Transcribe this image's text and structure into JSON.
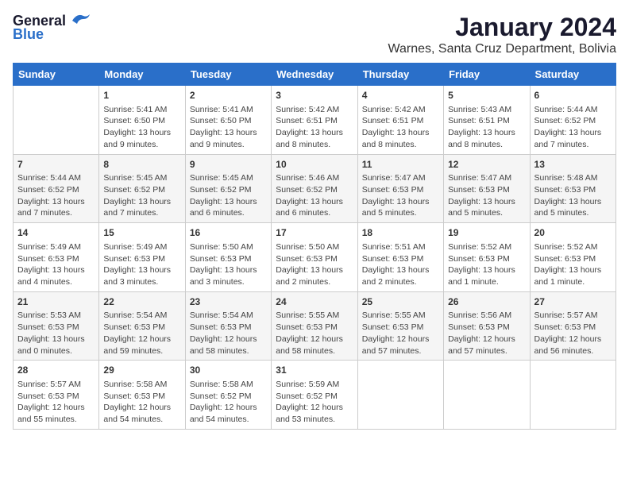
{
  "logo": {
    "general": "General",
    "blue": "Blue"
  },
  "title": "January 2024",
  "subtitle": "Warnes, Santa Cruz Department, Bolivia",
  "weekdays": [
    "Sunday",
    "Monday",
    "Tuesday",
    "Wednesday",
    "Thursday",
    "Friday",
    "Saturday"
  ],
  "weeks": [
    [
      {
        "day": "",
        "content": ""
      },
      {
        "day": "1",
        "content": "Sunrise: 5:41 AM\nSunset: 6:50 PM\nDaylight: 13 hours\nand 9 minutes."
      },
      {
        "day": "2",
        "content": "Sunrise: 5:41 AM\nSunset: 6:50 PM\nDaylight: 13 hours\nand 9 minutes."
      },
      {
        "day": "3",
        "content": "Sunrise: 5:42 AM\nSunset: 6:51 PM\nDaylight: 13 hours\nand 8 minutes."
      },
      {
        "day": "4",
        "content": "Sunrise: 5:42 AM\nSunset: 6:51 PM\nDaylight: 13 hours\nand 8 minutes."
      },
      {
        "day": "5",
        "content": "Sunrise: 5:43 AM\nSunset: 6:51 PM\nDaylight: 13 hours\nand 8 minutes."
      },
      {
        "day": "6",
        "content": "Sunrise: 5:44 AM\nSunset: 6:52 PM\nDaylight: 13 hours\nand 7 minutes."
      }
    ],
    [
      {
        "day": "7",
        "content": "Sunrise: 5:44 AM\nSunset: 6:52 PM\nDaylight: 13 hours\nand 7 minutes."
      },
      {
        "day": "8",
        "content": "Sunrise: 5:45 AM\nSunset: 6:52 PM\nDaylight: 13 hours\nand 7 minutes."
      },
      {
        "day": "9",
        "content": "Sunrise: 5:45 AM\nSunset: 6:52 PM\nDaylight: 13 hours\nand 6 minutes."
      },
      {
        "day": "10",
        "content": "Sunrise: 5:46 AM\nSunset: 6:52 PM\nDaylight: 13 hours\nand 6 minutes."
      },
      {
        "day": "11",
        "content": "Sunrise: 5:47 AM\nSunset: 6:53 PM\nDaylight: 13 hours\nand 5 minutes."
      },
      {
        "day": "12",
        "content": "Sunrise: 5:47 AM\nSunset: 6:53 PM\nDaylight: 13 hours\nand 5 minutes."
      },
      {
        "day": "13",
        "content": "Sunrise: 5:48 AM\nSunset: 6:53 PM\nDaylight: 13 hours\nand 5 minutes."
      }
    ],
    [
      {
        "day": "14",
        "content": "Sunrise: 5:49 AM\nSunset: 6:53 PM\nDaylight: 13 hours\nand 4 minutes."
      },
      {
        "day": "15",
        "content": "Sunrise: 5:49 AM\nSunset: 6:53 PM\nDaylight: 13 hours\nand 3 minutes."
      },
      {
        "day": "16",
        "content": "Sunrise: 5:50 AM\nSunset: 6:53 PM\nDaylight: 13 hours\nand 3 minutes."
      },
      {
        "day": "17",
        "content": "Sunrise: 5:50 AM\nSunset: 6:53 PM\nDaylight: 13 hours\nand 2 minutes."
      },
      {
        "day": "18",
        "content": "Sunrise: 5:51 AM\nSunset: 6:53 PM\nDaylight: 13 hours\nand 2 minutes."
      },
      {
        "day": "19",
        "content": "Sunrise: 5:52 AM\nSunset: 6:53 PM\nDaylight: 13 hours\nand 1 minute."
      },
      {
        "day": "20",
        "content": "Sunrise: 5:52 AM\nSunset: 6:53 PM\nDaylight: 13 hours\nand 1 minute."
      }
    ],
    [
      {
        "day": "21",
        "content": "Sunrise: 5:53 AM\nSunset: 6:53 PM\nDaylight: 13 hours\nand 0 minutes."
      },
      {
        "day": "22",
        "content": "Sunrise: 5:54 AM\nSunset: 6:53 PM\nDaylight: 12 hours\nand 59 minutes."
      },
      {
        "day": "23",
        "content": "Sunrise: 5:54 AM\nSunset: 6:53 PM\nDaylight: 12 hours\nand 58 minutes."
      },
      {
        "day": "24",
        "content": "Sunrise: 5:55 AM\nSunset: 6:53 PM\nDaylight: 12 hours\nand 58 minutes."
      },
      {
        "day": "25",
        "content": "Sunrise: 5:55 AM\nSunset: 6:53 PM\nDaylight: 12 hours\nand 57 minutes."
      },
      {
        "day": "26",
        "content": "Sunrise: 5:56 AM\nSunset: 6:53 PM\nDaylight: 12 hours\nand 57 minutes."
      },
      {
        "day": "27",
        "content": "Sunrise: 5:57 AM\nSunset: 6:53 PM\nDaylight: 12 hours\nand 56 minutes."
      }
    ],
    [
      {
        "day": "28",
        "content": "Sunrise: 5:57 AM\nSunset: 6:53 PM\nDaylight: 12 hours\nand 55 minutes."
      },
      {
        "day": "29",
        "content": "Sunrise: 5:58 AM\nSunset: 6:53 PM\nDaylight: 12 hours\nand 54 minutes."
      },
      {
        "day": "30",
        "content": "Sunrise: 5:58 AM\nSunset: 6:52 PM\nDaylight: 12 hours\nand 54 minutes."
      },
      {
        "day": "31",
        "content": "Sunrise: 5:59 AM\nSunset: 6:52 PM\nDaylight: 12 hours\nand 53 minutes."
      },
      {
        "day": "",
        "content": ""
      },
      {
        "day": "",
        "content": ""
      },
      {
        "day": "",
        "content": ""
      }
    ]
  ]
}
